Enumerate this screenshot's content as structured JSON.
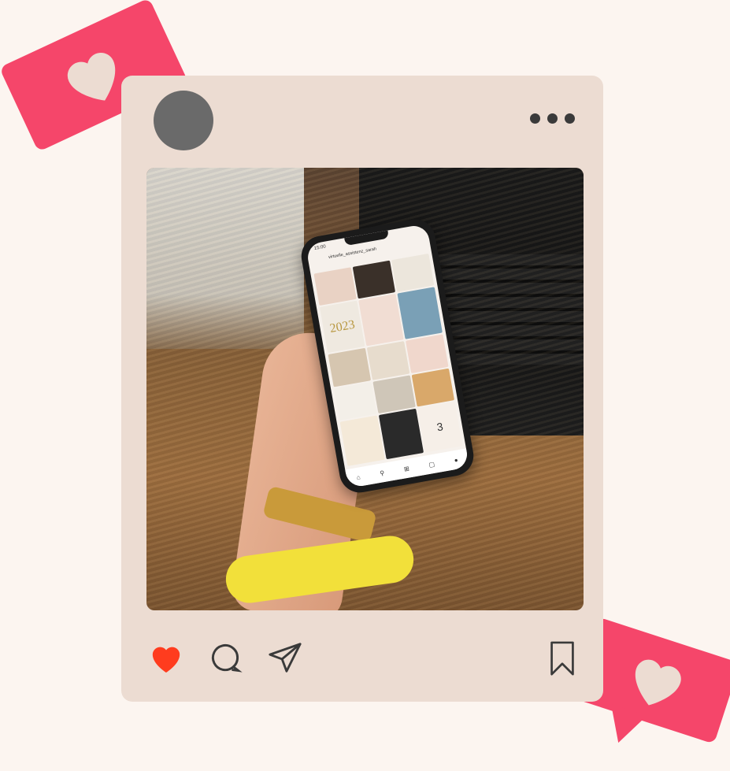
{
  "colors": {
    "background": "#fcf5f0",
    "card": "#ecdcd2",
    "bubble": "#f5466a",
    "heart_in_bubble": "#ecdcd2",
    "like_active": "#ff3c1e",
    "icon": "#3a3a3a",
    "avatar": "#6a6a6a"
  },
  "post": {
    "avatar": "avatar-placeholder",
    "more_icon": "ellipsis-icon"
  },
  "phone_screen": {
    "status_time": "15:00",
    "username": "virtuelle_assistenz_sarah",
    "year_tile": "2023",
    "number_tile": "3"
  },
  "actions": {
    "like": {
      "icon": "heart-filled-icon",
      "liked": true
    },
    "comment": {
      "icon": "comment-icon"
    },
    "share": {
      "icon": "send-icon"
    },
    "save": {
      "icon": "bookmark-icon"
    }
  },
  "decorations": {
    "top_left": "like-notification-bubble",
    "bottom_right": "like-notification-bubble"
  }
}
